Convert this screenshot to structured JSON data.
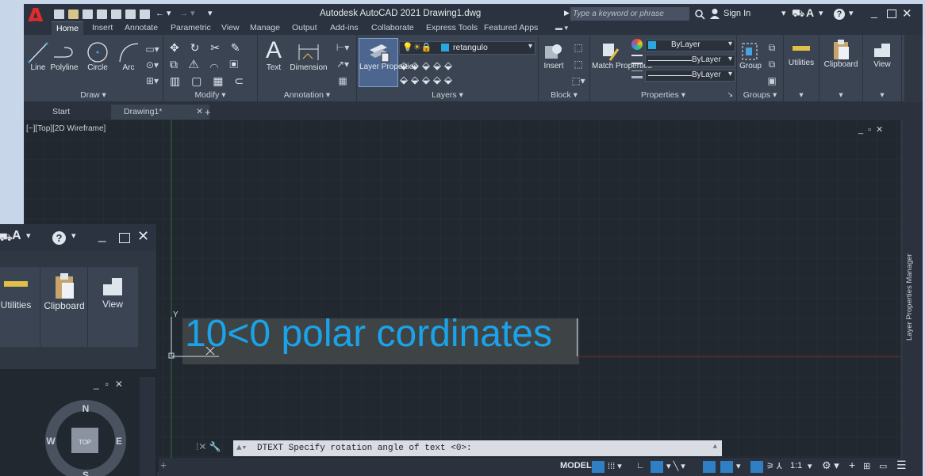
{
  "app": {
    "title": "Autodesk AutoCAD 2021   Drawing1.dwg",
    "search_placeholder": "Type a keyword or phrase",
    "sign_in": "Sign In",
    "logo_letter": "A"
  },
  "ribbon_tabs": [
    "Home",
    "Insert",
    "Annotate",
    "Parametric",
    "View",
    "Manage",
    "Output",
    "Add-ins",
    "Collaborate",
    "Express Tools",
    "Featured Apps"
  ],
  "draw_panel": {
    "label": "Draw ▾",
    "tools": [
      "Line",
      "Polyline",
      "Circle",
      "Arc"
    ]
  },
  "modify_panel": {
    "label": "Modify ▾"
  },
  "annotation_panel": {
    "label": "Annotation ▾",
    "tools": [
      "Text",
      "Dimension"
    ]
  },
  "layers_panel": {
    "label": "Layers ▾",
    "layer_properties": "Layer Properties",
    "current_layer": "retangulo"
  },
  "block_panel": {
    "label": "Block ▾",
    "insert": "Insert"
  },
  "properties_panel": {
    "label": "Properties ▾",
    "match": "Match Properties",
    "color": "ByLayer",
    "linetype": "ByLayer",
    "lineweight": "ByLayer"
  },
  "groups_panel": {
    "label": "Groups ▾",
    "group": "Group"
  },
  "utilities": "Utilities",
  "clipboard": "Clipboard",
  "view": "View",
  "doc_tabs": {
    "start": "Start",
    "drawing": "Drawing1*",
    "close": "✕",
    "add": "+"
  },
  "viewport": {
    "label": "[−][Top][2D Wireframe]"
  },
  "drawing_text": "10<0 polar cordinates",
  "side_palette": "Layer Properties Manager",
  "command": {
    "prompt": "DTEXT Specify rotation angle of text <0>:"
  },
  "status": {
    "model": "MODEL",
    "scale": "1:1"
  },
  "viewcube": {
    "n": "N",
    "s": "S",
    "e": "E",
    "w": "W",
    "top": "TOP"
  },
  "colors": {
    "accent": "#1aa3e8",
    "layer_swatch": "#29a8e0",
    "logo": "#e12b2b"
  }
}
